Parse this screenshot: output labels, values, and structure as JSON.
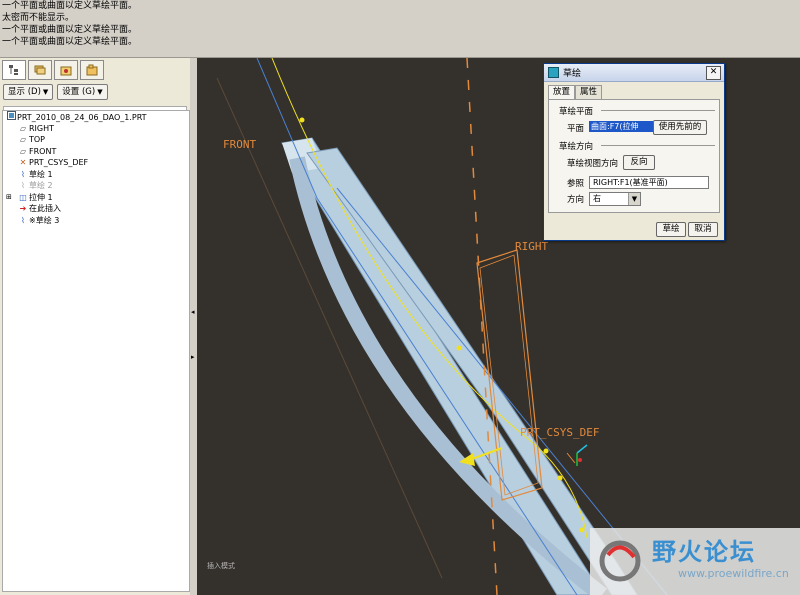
{
  "messages": [
    "一个平面或曲面以定义草绘平面。",
    "太密而不能显示。",
    "一个平面或曲面以定义草绘平面。",
    "一个平面或曲面以定义草绘平面。"
  ],
  "left_panel": {
    "tabs": [
      "model-tree-icon",
      "layers-icon",
      "favorites-icon",
      "folder-icon"
    ],
    "show_button": "显示 (D)",
    "settings_button": "设置 (G)",
    "tree": [
      {
        "label": "PRT_2010_08_24_06_DAO_1.PRT",
        "icon": "part-icon",
        "indent": 0
      },
      {
        "label": "RIGHT",
        "icon": "datum-plane-icon",
        "indent": 1
      },
      {
        "label": "TOP",
        "icon": "datum-plane-icon",
        "indent": 1
      },
      {
        "label": "FRONT",
        "icon": "datum-plane-icon",
        "indent": 1
      },
      {
        "label": "PRT_CSYS_DEF",
        "icon": "csys-icon",
        "indent": 1
      },
      {
        "label": "草绘 1",
        "icon": "sketch-icon",
        "indent": 1
      },
      {
        "label": "草绘 2",
        "icon": "sketch-icon",
        "indent": 1,
        "dim": true
      },
      {
        "label": "拉伸 1",
        "icon": "extrude-icon",
        "indent": 1,
        "expand": true
      },
      {
        "label": "在此插入",
        "icon": "insert-here-icon",
        "indent": 1
      },
      {
        "label": "※草绘 3",
        "icon": "sketch-icon",
        "indent": 1
      }
    ]
  },
  "viewport": {
    "labels": {
      "front": "FRONT",
      "right": "RIGHT",
      "csys": "PRT_CSYS_DEF"
    },
    "status_hint": "插入模式"
  },
  "dialog": {
    "title": "草绘",
    "tabs": [
      "放置",
      "属性"
    ],
    "section_plane": "草绘平面",
    "plane_label": "平面",
    "plane_value": "曲面:F7(拉伸",
    "use_prev_button": "使用先前的",
    "section_orientation": "草绘方向",
    "view_dir_label": "草绘视图方向",
    "flip_button": "反向",
    "reference_label": "参照",
    "reference_value": "RIGHT:F1(基准平面)",
    "orientation_label": "方向",
    "orientation_value": "右",
    "sketch_button": "草绘",
    "cancel_button": "取消"
  },
  "watermark": {
    "title": "野火论坛",
    "url": "www.proewildfire.cn"
  },
  "colors": {
    "viewport_bg": "#34302b",
    "surface": "#b8cfe0",
    "datum_orange": "#e28a3c",
    "sketch_yellow": "#f0e020",
    "selection_blue": "#1d57c8"
  }
}
